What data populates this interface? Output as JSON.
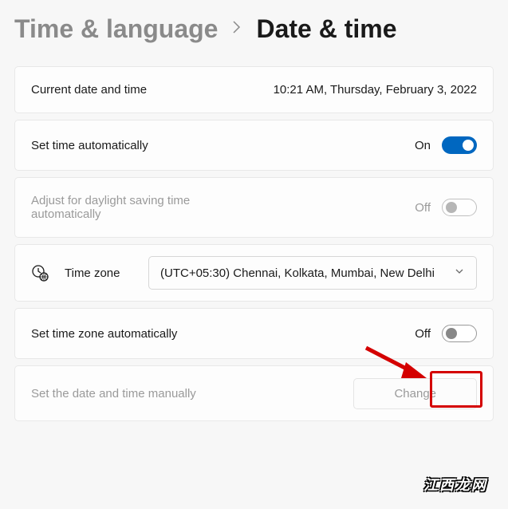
{
  "breadcrumb": {
    "parent": "Time & language",
    "current": "Date & time"
  },
  "rows": {
    "current": {
      "label": "Current date and time",
      "value": "10:21 AM, Thursday, February 3, 2022"
    },
    "auto_time": {
      "label": "Set time automatically",
      "state": "On"
    },
    "dst": {
      "label": "Adjust for daylight saving time automatically",
      "state": "Off"
    },
    "tz": {
      "label": "Time zone",
      "selected": "(UTC+05:30) Chennai, Kolkata, Mumbai, New Delhi"
    },
    "auto_tz": {
      "label": "Set time zone automatically",
      "state": "Off"
    },
    "manual": {
      "label": "Set the date and time manually",
      "button": "Change"
    }
  },
  "watermark": "江西龙网"
}
